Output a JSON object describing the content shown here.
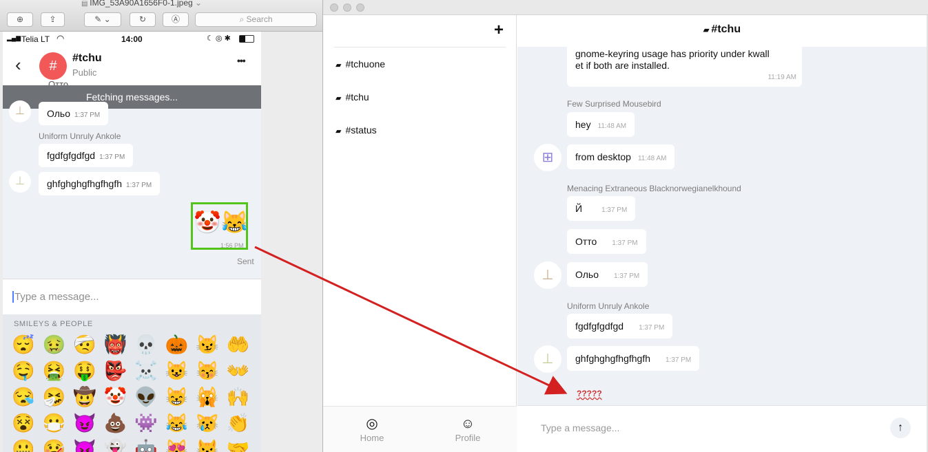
{
  "preview_window": {
    "title": "IMG_53A90A1656F0-1.jpeg",
    "search_placeholder": "Search",
    "icons": [
      "zoom-in-icon",
      "share-icon",
      "pen-icon",
      "rotate-icon",
      "annotate-icon"
    ]
  },
  "phone": {
    "status": {
      "carrier": "Telia LT",
      "time": "14:00"
    },
    "header": {
      "avatar_glyph": "#",
      "title": "#tchu",
      "subtitle": "Public",
      "menu_glyph": "•••"
    },
    "fetch_banner": "Fetching messages...",
    "clipped_text": "Отто",
    "messages": [
      {
        "text": "Ольо",
        "time": "1:37 PM"
      },
      {
        "author": "Uniform Unruly Ankole",
        "text": "fgdfgfgdfgd",
        "time": "1:37 PM"
      },
      {
        "text": "ghfghghgfhgfhgfh",
        "time": "1:37 PM"
      },
      {
        "emoji": "🤡😹",
        "time": "1:56 PM",
        "status": "Sent"
      }
    ],
    "input_placeholder": "Type a message...",
    "emoji_section_title": "SMILEYS & PEOPLE",
    "emoji_grid": [
      [
        "😴",
        "🤢",
        "🤕",
        "👹",
        "💀",
        "🎃",
        "😼",
        "🤲"
      ],
      [
        "🤤",
        "🤮",
        "🤑",
        "👺",
        "☠️",
        "😺",
        "😽",
        "👐"
      ],
      [
        "😪",
        "🤧",
        "🤠",
        "🤡",
        "👽",
        "😸",
        "🙀",
        "🙌"
      ],
      [
        "😵",
        "😷",
        "😈",
        "💩",
        "👾",
        "😹",
        "😿",
        "👏"
      ],
      [
        "🤐",
        "🤒",
        "👿",
        "👻",
        "🤖",
        "😻",
        "😾",
        "🤝"
      ]
    ]
  },
  "app": {
    "channels": [
      {
        "name": "#tchuone"
      },
      {
        "name": "#tchu"
      },
      {
        "name": "#status"
      }
    ],
    "chat_title": "#tchu",
    "messages": [
      {
        "text_line1": "gnome-keyring usage has priority under kwall",
        "text_line2": "et if both are installed.",
        "time": "11:19 AM"
      },
      {
        "author": "Few Surprised Mousebird",
        "text": "hey",
        "time": "11:48 AM"
      },
      {
        "text": "from desktop",
        "time": "11:48 AM"
      },
      {
        "author": "Menacing Extraneous Blacknorwegianelkhound",
        "text": "Й",
        "time": "1:37 PM"
      },
      {
        "text": "Отто",
        "time": "1:37 PM"
      },
      {
        "text": "Ольо",
        "time": "1:37 PM"
      },
      {
        "author": "Uniform Unruly Ankole",
        "text": "fgdfgfgdfgd",
        "time": "1:37 PM"
      },
      {
        "text": "ghfghghgfhgfhgfh",
        "time": "1:37 PM"
      },
      {
        "text": "?????"
      }
    ],
    "input_placeholder": "Type a message...",
    "nav": [
      {
        "label": "Home",
        "icon": "home-icon"
      },
      {
        "label": "Profile",
        "icon": "profile-icon"
      }
    ]
  },
  "colors": {
    "annotation_arrow": "#d32020",
    "highlight_box": "#52c41a",
    "avatar_red": "#f25858"
  }
}
